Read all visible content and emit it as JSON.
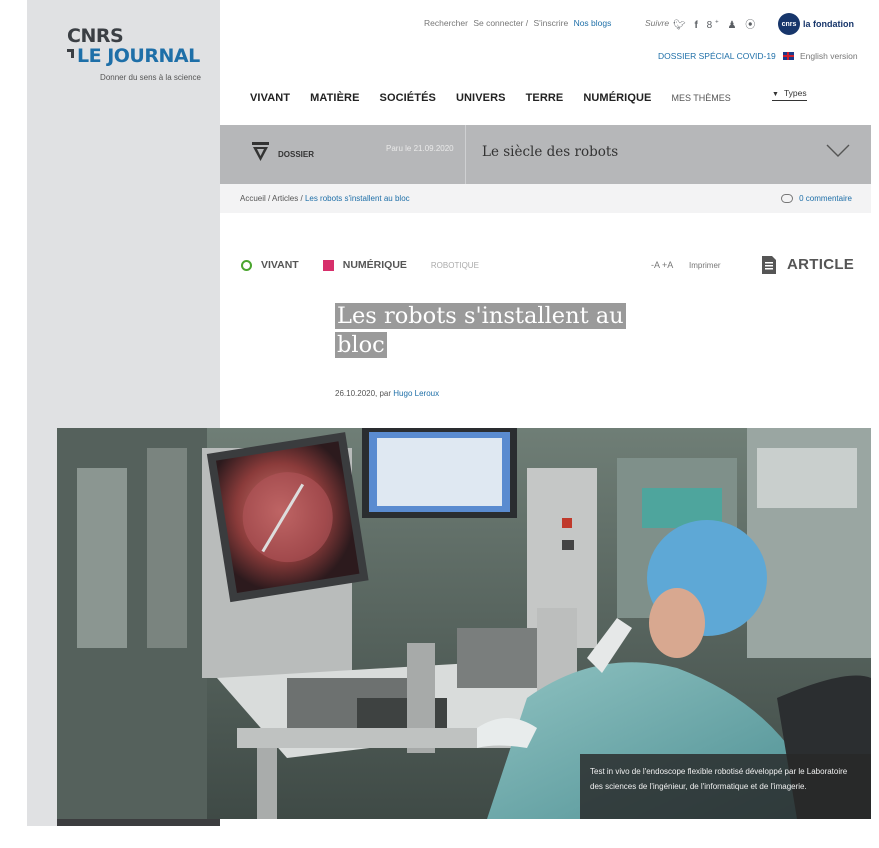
{
  "brand": {
    "line1": "CNRS",
    "line2": "LE JOURNAL",
    "tagline": "Donner du sens à la science"
  },
  "header": {
    "links": [
      "Rechercher",
      "Se connecter /",
      "S'inscrire",
      "Nos blogs"
    ],
    "follow_label": "Suivre",
    "social_icons": [
      "twitter-icon",
      "facebook-icon",
      "google-plus-icon",
      "user-icon",
      "rss-icon"
    ],
    "fondation_badge": "cnrs",
    "fondation_label": "la fondation",
    "covid_link": "DOSSIER SPÉCIAL COVID-19",
    "english_link": "English version"
  },
  "nav": {
    "items": [
      "VIVANT",
      "MATIÈRE",
      "SOCIÉTÉS",
      "UNIVERS",
      "TERRE",
      "NUMÉRIQUE"
    ],
    "themes": "MES THÈMES",
    "types": "Types"
  },
  "dossier": {
    "label": "DOSSIER",
    "date": "Paru le 21.09.2020",
    "title": "Le siècle des robots"
  },
  "breadcrumb": {
    "home": "Accueil",
    "section": "Articles",
    "current": "Les robots s'installent au bloc",
    "comments": "0 commentaire"
  },
  "article": {
    "categories": [
      "VIVANT",
      "NUMÉRIQUE"
    ],
    "tag": "ROBOTIQUE",
    "font_size_control": "-A +A",
    "print": "Imprimer",
    "type_label": "ARTICLE",
    "title_line1": "Les robots s'installent au",
    "title_line2": "bloc",
    "date": "26.10.2020, par",
    "author": "Hugo Leroux",
    "caption": "Test in vivo de l'endoscope flexible robotisé développé par le Laboratoire des sciences de l'ingénieur, de l'informatique et de l'imagerie."
  },
  "colors": {
    "accent": "#1e6fa8",
    "vivant": "#4aa52e",
    "numerique": "#d72f6b",
    "sidebar": "#e0e1e3",
    "dossier_bar": "#b6b7b9"
  }
}
